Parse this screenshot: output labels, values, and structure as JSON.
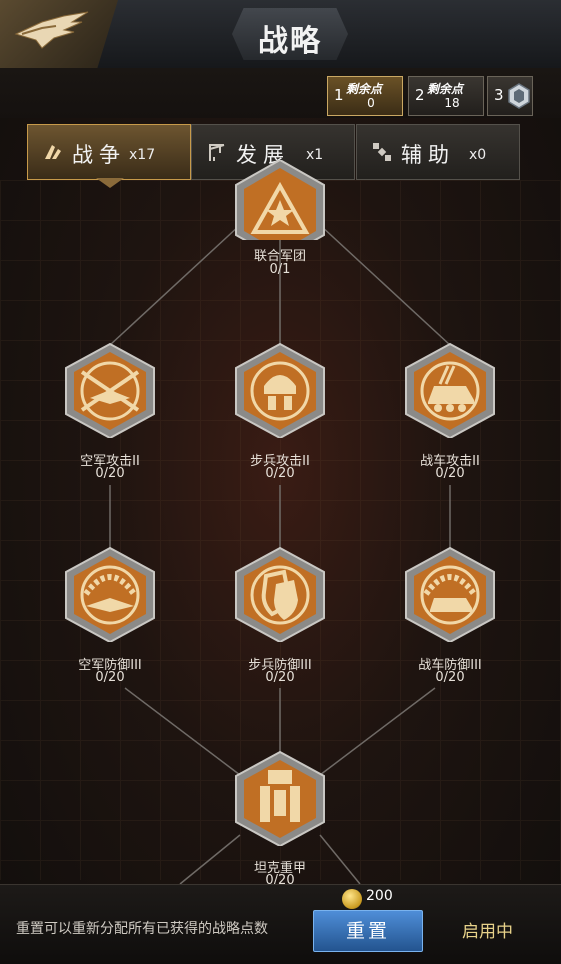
{
  "header": {
    "title": "战略",
    "back_icon": "eagle-logo-icon"
  },
  "points": [
    {
      "index": "1",
      "label": "剩余点",
      "value": "0",
      "active": true
    },
    {
      "index": "2",
      "label": "剩余点",
      "value": "18",
      "active": false
    },
    {
      "index": "3",
      "label": "",
      "value": "",
      "active": false,
      "icon": "rank-badge-icon"
    }
  ],
  "tabs": [
    {
      "label": "战争",
      "count": "x17",
      "icon": "war-icon",
      "active": true
    },
    {
      "label": "发展",
      "count": "x1",
      "icon": "crane-icon",
      "active": false
    },
    {
      "label": "辅助",
      "count": "x0",
      "icon": "satellite-icon",
      "active": false
    }
  ],
  "nodes": [
    {
      "name": "联合军团",
      "value": "0/1",
      "icon": "star-triangle-icon"
    },
    {
      "name": "空军攻击II",
      "value": "0/20",
      "icon": "jet-crosshair-icon"
    },
    {
      "name": "步兵攻击II",
      "value": "0/20",
      "icon": "soldier-icon"
    },
    {
      "name": "战车攻击II",
      "value": "0/20",
      "icon": "armored-vehicle-icon"
    },
    {
      "name": "空军防御III",
      "value": "0/20",
      "icon": "jet-shield-icon"
    },
    {
      "name": "步兵防御III",
      "value": "0/20",
      "icon": "double-shield-icon"
    },
    {
      "name": "战车防御III",
      "value": "0/20",
      "icon": "vehicle-shield-icon"
    },
    {
      "name": "坦克重甲",
      "value": "0/20",
      "icon": "tank-armor-icon"
    }
  ],
  "footer": {
    "hint": "重置可以重新分配所有已获得的战略点数",
    "cost": "200",
    "reset_label": "重置",
    "status": "启用中"
  },
  "colors": {
    "accent_gold": "#c79a4a",
    "node_orange": "#c9772a",
    "reset_blue": "#3a74bd"
  }
}
